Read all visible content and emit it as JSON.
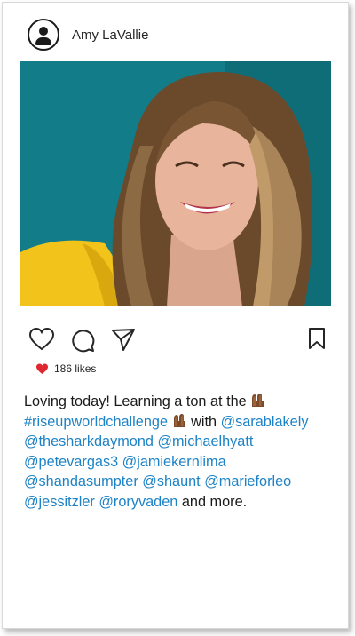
{
  "post": {
    "username": "Amy LaVallie",
    "likes": "186 likes",
    "caption": {
      "text1": "Loving today! Learning a ton at the",
      "hashtag": "#riseupworldchallenge",
      "text2": "with",
      "mentions": [
        "@sarablakely",
        "@thesharkdaymond",
        "@michaelhyatt",
        "@petevargas3",
        "@jamiekernlima",
        "@shandasumpter",
        "@shaunt",
        "@marieforleo",
        "@jessitzler",
        "@roryvaden"
      ],
      "text3": "and more."
    }
  },
  "colors": {
    "heart": "#e0262e",
    "link": "#1d83c6",
    "photo_bg": "#117a86"
  },
  "icons": [
    "profile-icon",
    "heart-icon",
    "comment-icon",
    "share-icon",
    "bookmark-icon",
    "liked-heart-icon",
    "raised-hands-emoji"
  ]
}
